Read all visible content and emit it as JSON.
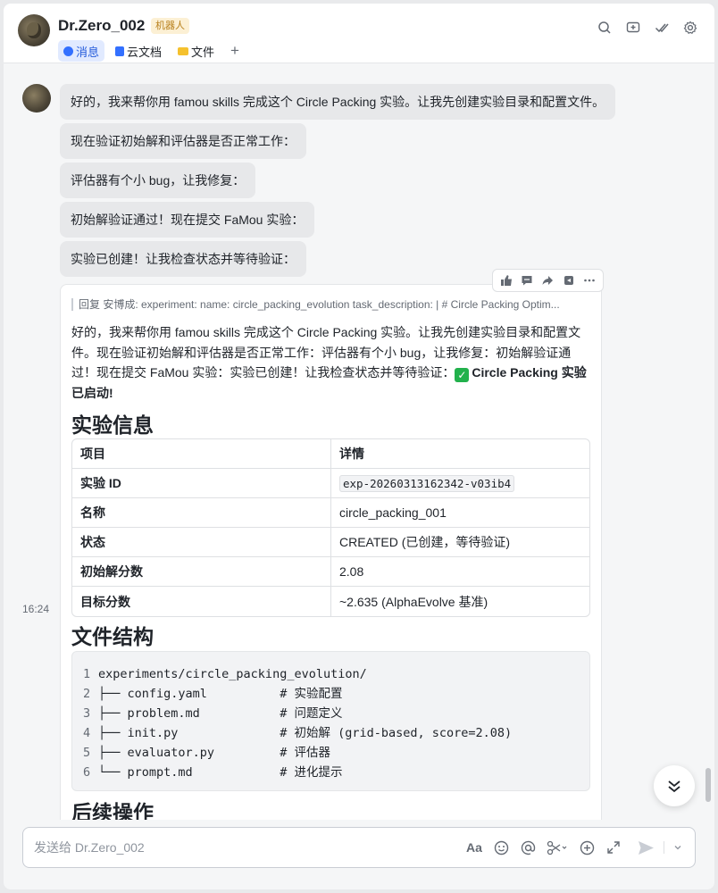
{
  "header": {
    "name": "Dr.Zero_002",
    "badge": "机器人",
    "tabs": [
      {
        "label": "消息",
        "active": true
      },
      {
        "label": "云文档",
        "active": false
      },
      {
        "label": "文件",
        "active": false
      }
    ],
    "add_tab": "+"
  },
  "messages": [
    "好的，我来帮你用 famou skills 完成这个 Circle Packing 实验。让我先创建实验目录和配置文件。",
    "现在验证初始解和评估器是否正常工作：",
    "评估器有个小 bug，让我修复：",
    "初始解验证通过！现在提交 FaMou 实验：",
    "实验已创建！让我检查状态并等待验证："
  ],
  "reply": {
    "quote": "回复 安博成:  experiment: name: circle_packing_evolution task_description: | # Circle Packing Optim...",
    "text": "好的，我来帮你用 famou skills 完成这个 Circle Packing 实验。让我先创建实验目录和配置文件。现在验证初始解和评估器是否正常工作：评估器有个小 bug，让我修复：初始解验证通过！现在提交 FaMou 实验：实验已创建！让我检查状态并等待验证：",
    "check_symbol": "✓",
    "bold_text": "Circle Packing 实验已启动!",
    "section1_title": "实验信息",
    "table": {
      "header": [
        "项目",
        "详情"
      ],
      "rows": [
        [
          "实验 ID",
          "exp-20260313162342-v03ib4"
        ],
        [
          "名称",
          "circle_packing_001"
        ],
        [
          "状态",
          "CREATED (已创建，等待验证)"
        ],
        [
          "初始解分数",
          "2.08"
        ],
        [
          "目标分数",
          "~2.635 (AlphaEvolve 基准)"
        ]
      ]
    },
    "section2_title": "文件结构",
    "code_lines": [
      {
        "no": "1",
        "text": "experiments/circle_packing_evolution/"
      },
      {
        "no": "2",
        "text": "├── config.yaml          # 实验配置"
      },
      {
        "no": "3",
        "text": "├── problem.md           # 问题定义"
      },
      {
        "no": "4",
        "text": "├── init.py              # 初始解 (grid-based, score=2.08)"
      },
      {
        "no": "5",
        "text": "├── evaluator.py         # 评估器"
      },
      {
        "no": "6",
        "text": "└── prompt.md            # 进化提示"
      }
    ],
    "section3_title": "后续操作"
  },
  "timestamp": "16:24",
  "input": {
    "placeholder": "发送给 Dr.Zero_002",
    "aa_label": "Aa"
  },
  "colors": {
    "accent": "#3370ff",
    "bubble_bg": "#e7e8ea",
    "badge_bg": "#fcf0d4",
    "badge_text": "#b8801c"
  }
}
